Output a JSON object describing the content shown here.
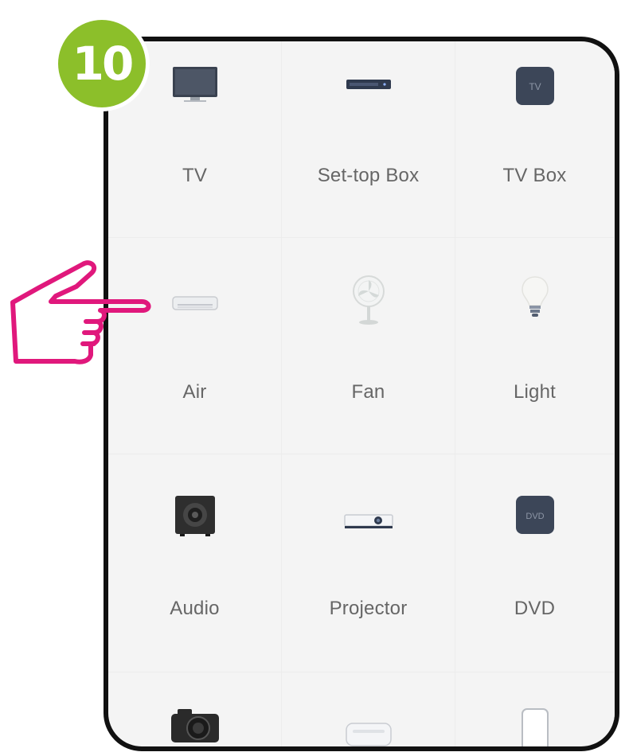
{
  "step": {
    "number": "10",
    "color": "#8cbf2a"
  },
  "pointer": {
    "color": "#e0187c",
    "target": "Air"
  },
  "devices": [
    {
      "label": "TV",
      "icon": "tv-icon"
    },
    {
      "label": "Set-top Box",
      "icon": "set-top-box-icon"
    },
    {
      "label": "TV Box",
      "icon": "tv-box-icon"
    },
    {
      "label": "Air",
      "icon": "air-conditioner-icon"
    },
    {
      "label": "Fan",
      "icon": "fan-icon"
    },
    {
      "label": "Light",
      "icon": "light-bulb-icon"
    },
    {
      "label": "Audio",
      "icon": "speaker-icon"
    },
    {
      "label": "Projector",
      "icon": "projector-icon"
    },
    {
      "label": "DVD",
      "icon": "dvd-icon"
    },
    {
      "label": "",
      "icon": "camera-icon"
    },
    {
      "label": "",
      "icon": "air-purifier-icon"
    },
    {
      "label": "",
      "icon": "water-heater-icon"
    }
  ],
  "icon_text": {
    "tv_box": "TV",
    "dvd": "DVD"
  }
}
